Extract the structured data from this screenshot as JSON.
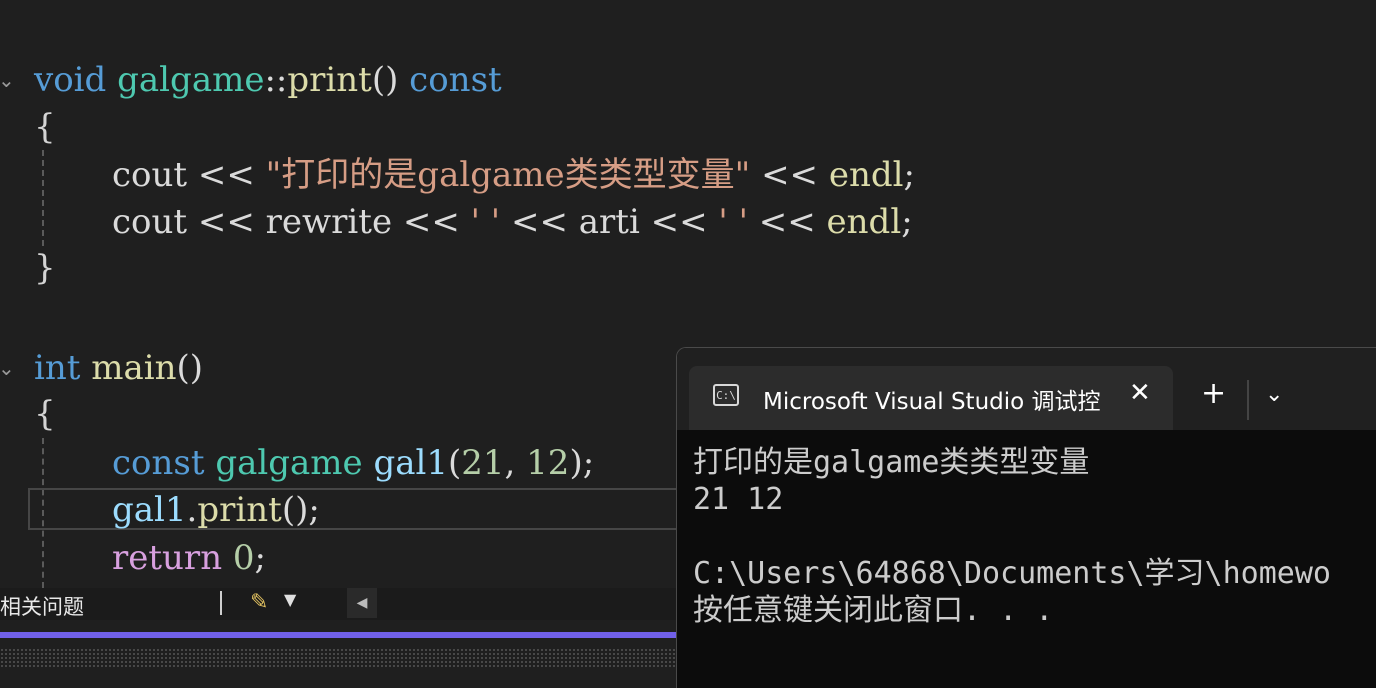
{
  "editor": {
    "lines": [
      {
        "t1": "void",
        "t2": " ",
        "t3": "galgame",
        "t4": "::",
        "t5": "print",
        "t6": "() ",
        "t7": "const"
      },
      {
        "t1": "{"
      },
      {
        "t1": "cout",
        "t2": " << ",
        "t3": "\"打印的是galgame类类型变量\"",
        "t4": " << ",
        "t5": "endl",
        "t6": ";"
      },
      {
        "t1": "cout",
        "t2": " << ",
        "t3": "rewrite",
        "t4": " << ",
        "t5": "' '",
        "t6": " << ",
        "t7": "arti",
        "t8": " << ",
        "t9": "' '",
        "t10": " << ",
        "t11": "endl",
        "t12": ";"
      },
      {
        "t1": "}"
      },
      {
        "t1": "int",
        "t2": " ",
        "t3": "main",
        "t4": "()"
      },
      {
        "t1": "{"
      },
      {
        "t1": "const",
        "t2": " ",
        "t3": "galgame",
        "t4": " ",
        "t5": "gal1",
        "t6": "(",
        "t7": "21",
        "t8": ", ",
        "t9": "12",
        "t10": ");"
      },
      {
        "t1": "gal1",
        "t2": ".",
        "t3": "print",
        "t4": "();"
      },
      {
        "t1": "return",
        "t2": " ",
        "t3": "0",
        "t4": ";"
      }
    ]
  },
  "statusbar": {
    "label": "相关问题",
    "brush_icon": "✎",
    "dropdown_icon": "▼",
    "scroll_left_icon": "◀"
  },
  "terminal": {
    "tab_icon_text": "C:\\",
    "tab_title": "Microsoft Visual Studio 调试控",
    "close_icon": "✕",
    "new_tab_icon": "+",
    "dropdown_icon": "⌄",
    "output": [
      "打印的是galgame类类型变量",
      "21 12",
      "",
      "C:\\Users\\64868\\Documents\\学习\\homewo",
      "按任意键关闭此窗口. . ."
    ]
  },
  "colors": {
    "keyword": "#569cd6",
    "type": "#4ec9b0",
    "function": "#dcdcaa",
    "string": "#d69d85",
    "number": "#b5cea8",
    "control": "#d8a0df",
    "accent_bar": "#7160e8"
  }
}
